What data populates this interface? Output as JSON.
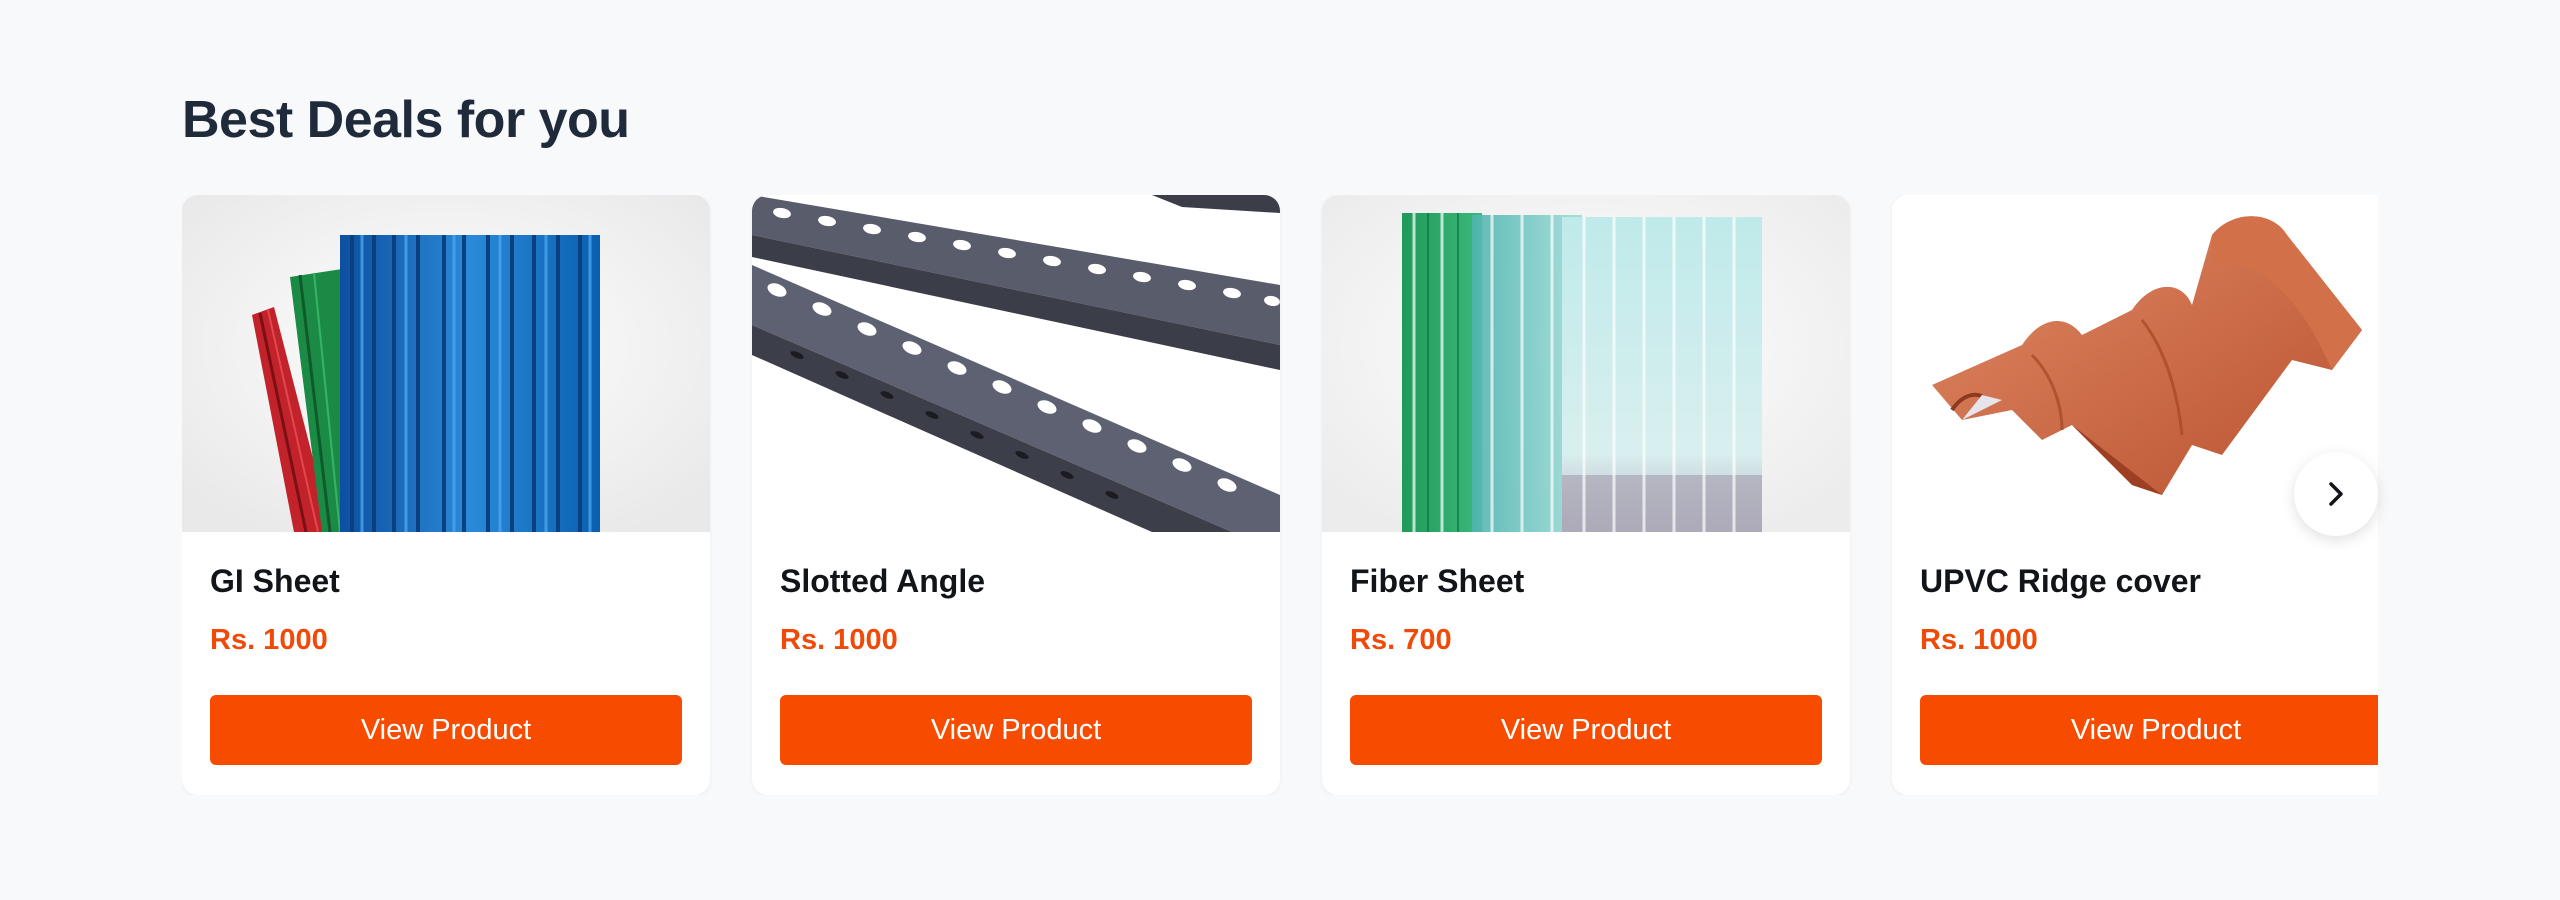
{
  "section": {
    "title": "Best Deals for you"
  },
  "products": [
    {
      "name": "GI Sheet",
      "price": "Rs. 1000",
      "button_label": "View Product",
      "image_icon": "gi-sheet-image"
    },
    {
      "name": "Slotted Angle",
      "price": "Rs. 1000",
      "button_label": "View Product",
      "image_icon": "slotted-angle-image"
    },
    {
      "name": "Fiber Sheet",
      "price": "Rs. 700",
      "button_label": "View Product",
      "image_icon": "fiber-sheet-image"
    },
    {
      "name": "UPVC Ridge cover",
      "price": "Rs. 1000",
      "button_label": "View Product",
      "image_icon": "upvc-ridge-cover-image"
    }
  ],
  "carousel": {
    "next_icon": "chevron-right-icon"
  },
  "colors": {
    "accent": "#f74b00",
    "price": "#f04a08",
    "heading": "#1f2a3a",
    "background": "#f8f9fb"
  }
}
